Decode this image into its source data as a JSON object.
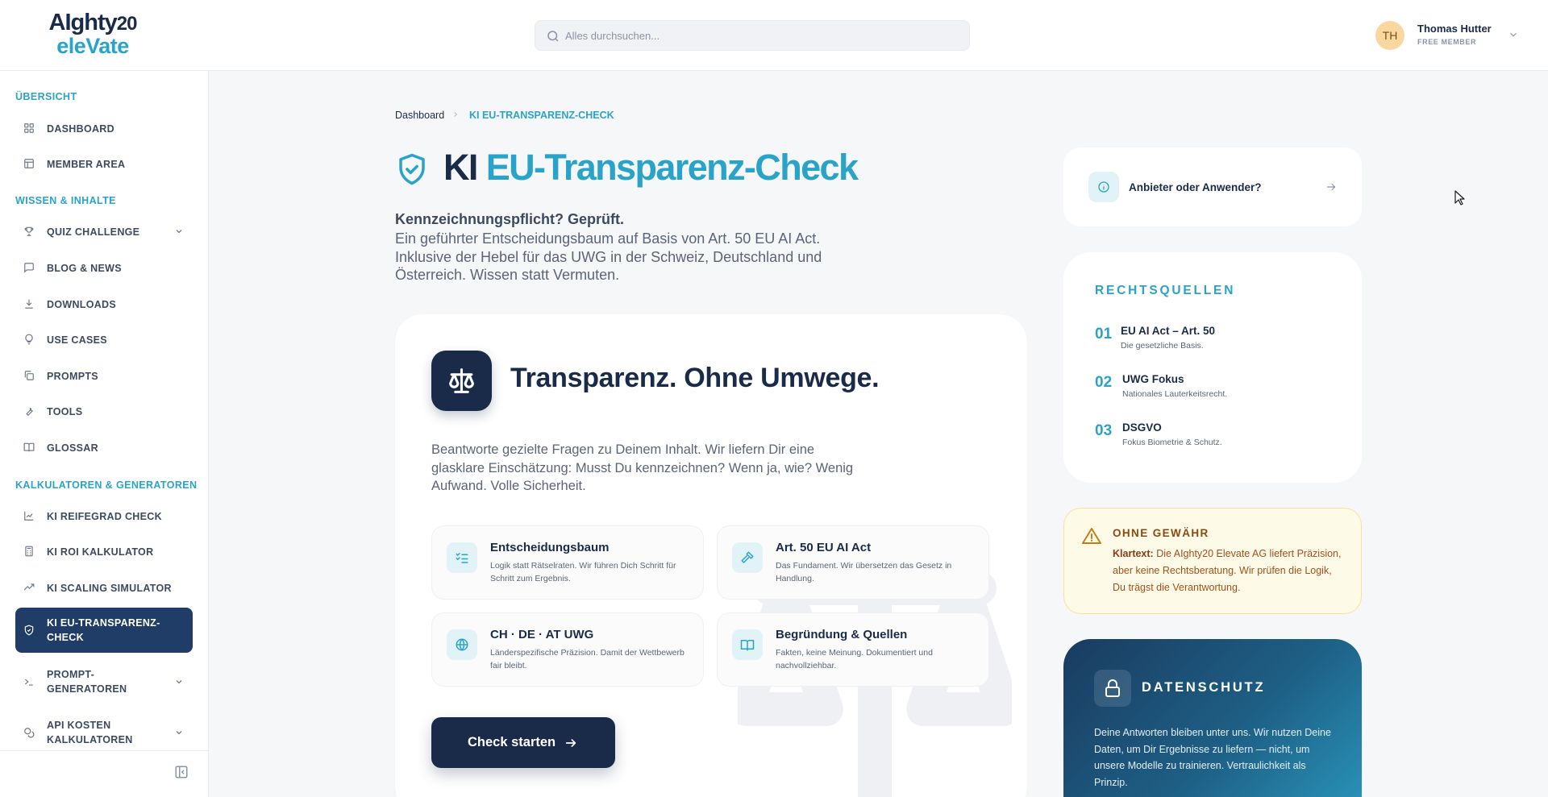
{
  "header": {
    "logo_line1": "AIghty",
    "logo_num": "20",
    "logo_line2": "eleVate",
    "search_placeholder": "Alles durchsuchen...",
    "user_initials": "TH",
    "user_name": "Thomas Hutter",
    "user_role": "FREE MEMBER"
  },
  "sidebar": {
    "sections": [
      "ÜBERSICHT",
      "WISSEN & INHALTE",
      "KALKULATOREN & GENERATOREN"
    ],
    "items": [
      {
        "label": "DASHBOARD",
        "icon": "grid-icon"
      },
      {
        "label": "MEMBER AREA",
        "icon": "layout-icon"
      },
      {
        "label": "QUIZ CHALLENGE",
        "icon": "trophy-icon"
      },
      {
        "label": "BLOG & NEWS",
        "icon": "chat-icon"
      },
      {
        "label": "DOWNLOADS",
        "icon": "download-icon"
      },
      {
        "label": "USE CASES",
        "icon": "lightbulb-icon"
      },
      {
        "label": "PROMPTS",
        "icon": "copy-icon"
      },
      {
        "label": "TOOLS",
        "icon": "wrench-icon"
      },
      {
        "label": "GLOSSAR",
        "icon": "book-icon"
      },
      {
        "label": "KI REIFEGRAD CHECK",
        "icon": "chart-icon"
      },
      {
        "label": "KI ROI KALKULATOR",
        "icon": "calculator-icon"
      },
      {
        "label": "KI SCALING SIMULATOR",
        "icon": "trend-icon"
      },
      {
        "label": "KI EU-TRANSPARENZ-CHECK",
        "icon": "shield-icon"
      },
      {
        "label": "PROMPT-GENERATOREN",
        "icon": "terminal-icon"
      },
      {
        "label": "API KOSTEN KALKULATOREN",
        "icon": "coins-icon"
      }
    ]
  },
  "breadcrumb": {
    "home": "Dashboard",
    "current": "KI EU-TRANSPARENZ-CHECK"
  },
  "hero": {
    "title_part1": "KI",
    "title_part2": "EU-Transparenz-Check",
    "subtitle_bold": "Kennzeichnungspflicht? Geprüft.",
    "subtitle": "Ein geführter Entscheidungsbaum auf Basis von Art. 50 EU AI Act. Inklusive der Hebel für das UWG in der Schweiz, Deutschland und Österreich. Wissen statt Vermuten."
  },
  "card": {
    "title": "Transparenz. Ohne Umwege.",
    "description": "Beantworte gezielte Fragen zu Deinem Inhalt. Wir liefern Dir eine glasklare Einschätzung: Musst Du kennzeichnen? Wenn ja, wie? Wenig Aufwand. Volle Sicherheit.",
    "features": [
      {
        "title": "Entscheidungsbaum",
        "desc": "Logik statt Rätselraten. Wir führen Dich Schritt für Schritt zum Ergebnis.",
        "icon": "checklist-icon"
      },
      {
        "title": "Art. 50 EU AI Act",
        "desc": "Das Fundament. Wir übersetzen das Gesetz in Handlung.",
        "icon": "gavel-icon"
      },
      {
        "title": "CH · DE · AT UWG",
        "desc": "Länderspezifische Präzision. Damit der Wettbewerb fair bleibt.",
        "icon": "globe-icon"
      },
      {
        "title": "Begründung & Quellen",
        "desc": "Fakten, keine Meinung. Dokumentiert und nachvollziehbar.",
        "icon": "open-book-icon"
      }
    ],
    "cta_label": "Check starten"
  },
  "right": {
    "provider_label": "Anbieter oder Anwender?",
    "sources_title": "RECHTSQUELLEN",
    "sources": [
      {
        "num": "01",
        "title": "EU AI Act – Art. 50",
        "desc": "Die gesetzliche Basis."
      },
      {
        "num": "02",
        "title": "UWG Fokus",
        "desc": "Nationales Lauterkeitsrecht."
      },
      {
        "num": "03",
        "title": "DSGVO",
        "desc": "Fokus Biometrie & Schutz."
      }
    ],
    "warning_title": "OHNE GEWÄHR",
    "warning_bold": "Klartext:",
    "warning_text": " Die AIghty20 Elevate AG liefert Präzision, aber keine Rechtsberatung. Wir prüfen die Logik, Du trägst die Verantwortung.",
    "privacy_title": "DATENSCHUTZ",
    "privacy_text": "Deine Antworten bleiben unter uns. Wir nutzen Deine Daten, um Dir Ergebnisse zu liefern — nicht, um unsere Modelle zu trainieren. Vertraulichkeit als Prinzip."
  },
  "colors": {
    "navy": "#1a2b4a",
    "accent": "#2aa3c8",
    "active_nav": "#1f3d66",
    "warning_bg": "#fefae8"
  }
}
